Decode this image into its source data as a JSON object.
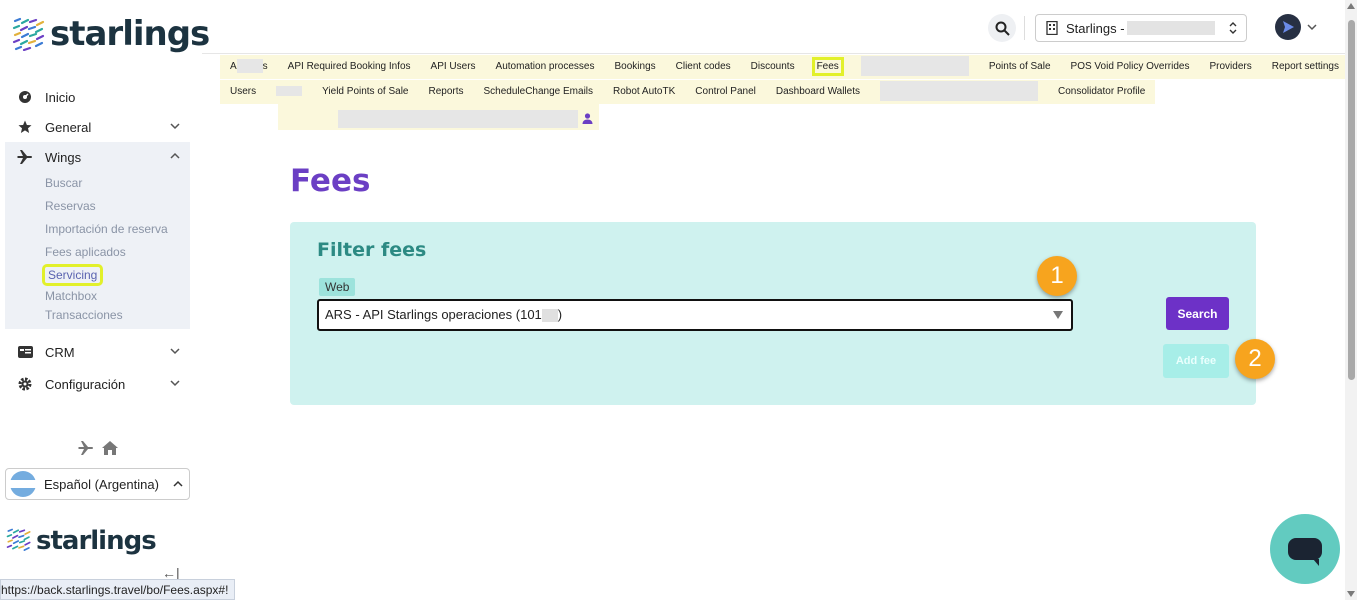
{
  "brand": {
    "name": "starlings"
  },
  "sidebar": {
    "items": [
      {
        "label": "Inicio",
        "icon": "dashboard-icon"
      },
      {
        "label": "General",
        "icon": "star-icon"
      },
      {
        "label": "Wings",
        "icon": "plane-icon"
      },
      {
        "label": "CRM",
        "icon": "card-icon"
      },
      {
        "label": "Configuración",
        "icon": "gear-icon"
      }
    ],
    "wings_sub": [
      "Buscar",
      "Reservas",
      "Importación de reserva",
      "Fees aplicados",
      "Servicing",
      "Matchbox",
      "Transacciones"
    ],
    "language": "Español (Argentina)",
    "collapse_glyph": "←|"
  },
  "header": {
    "company": "Starlings -"
  },
  "menu": {
    "row1": [
      "A",
      "s",
      "API Required Booking Infos",
      "API Users",
      "Automation processes",
      "Bookings",
      "Client codes",
      "Discounts",
      "Fees",
      "Points of Sale",
      "POS Void Policy Overrides",
      "Providers",
      "Report settings"
    ],
    "row2": [
      "Users",
      "Yield Points of Sale",
      "Reports",
      "ScheduleChange Emails",
      "Robot AutoTK",
      "Control Panel",
      "Dashboard Wallets",
      "Consolidator Profile"
    ]
  },
  "page": {
    "title": "Fees",
    "filter_title": "Filter fees",
    "web_label": "Web",
    "select_value": "ARS - API Starlings operaciones (101",
    "select_suffix": ")",
    "search_label": "Search",
    "addfee_label": "Add fee",
    "badge1": "1",
    "badge2": "2"
  },
  "status_url": "https://back.starlings.travel/bo/Fees.aspx#!",
  "colors": {
    "accent": "#6b3fc4",
    "panel": "#cff2ef",
    "highlight": "#e2f02b",
    "badge": "#f7a41e"
  }
}
